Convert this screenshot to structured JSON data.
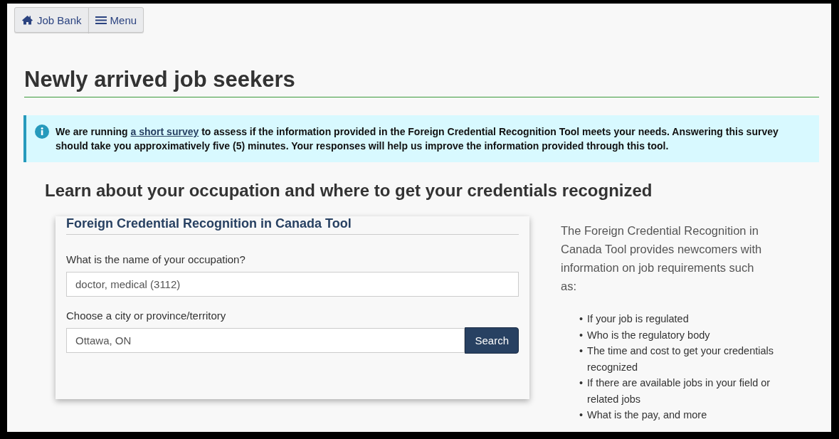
{
  "topbar": {
    "home_button": "Job Bank",
    "menu_button": "Menu"
  },
  "title": "Newly arrived job seekers",
  "alert": {
    "before": "We are running ",
    "link": "a short survey",
    "after": " to assess if the information provided in the Foreign Credential Recognition Tool meets your needs. Answering this survey should take you approximatively five (5) minutes. Your responses will help us improve the information provided through this tool."
  },
  "subtitle": "Learn about your occupation and where to get your credentials recognized",
  "tool": {
    "heading": "Foreign Credential Recognition in Canada Tool",
    "occupation_label": "What is the name of your occupation?",
    "occupation_value": "doctor, medical (3112)",
    "location_label": "Choose a city or province/territory",
    "location_value": "Ottawa, ON",
    "search_button": "Search"
  },
  "description": "The Foreign Credential Recognition in Canada Tool provides newcomers with information on job requirements such as:",
  "features": [
    {
      "marker": "•",
      "text": "If your job is regulated"
    },
    {
      "marker": "•",
      "text": "Who is the regulatory body"
    },
    {
      "marker": "•",
      "text": "The time and cost to get your credentials recognized"
    },
    {
      "marker": "•",
      "text": "If there are available jobs in your field or related jobs"
    },
    {
      "marker": "•",
      "text": "What is the pay, and more"
    }
  ]
}
